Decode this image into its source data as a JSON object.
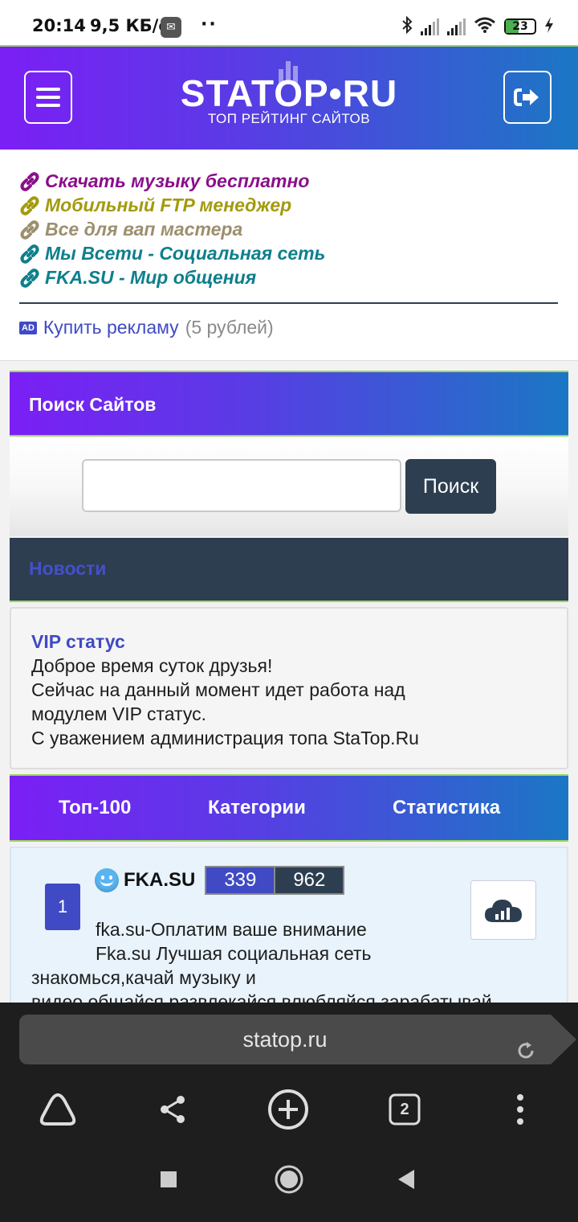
{
  "status_bar": {
    "time": "20:14",
    "speed": "9,5 КБ/с",
    "dots": "··",
    "battery": "23"
  },
  "header": {
    "logo_title": "STATOP•RU",
    "logo_subtitle": "ТОП РЕЙТИНГ САЙТОВ"
  },
  "links": [
    {
      "label": "Скачать музыку бесплатно",
      "color": "#8a0f8a"
    },
    {
      "label": "Мобильный FTP менеджер",
      "color": "#a39a0e"
    },
    {
      "label": "Все для вап мастера",
      "color": "#9b8f6e"
    },
    {
      "label": "Мы Всети - Социальная сеть",
      "color": "#0e7f8c"
    },
    {
      "label": "FKA.SU - Мир общения",
      "color": "#0e7f8c"
    }
  ],
  "ad": {
    "badge": "AD",
    "link": "Купить рекламу",
    "price": "(5 рублей)"
  },
  "search": {
    "title": "Поиск Сайтов",
    "value": "",
    "button": "Поиск"
  },
  "news": {
    "title": "Новости",
    "item_title": "VIP статус",
    "lines": [
      "Доброе время суток друзья!",
      "Сейчас на данный момент идет работа над",
      "модулем VIP статус.",
      "С уважением администрация топа StaTop.Ru"
    ]
  },
  "tabs": [
    "Топ-100",
    "Категории",
    "Статистика"
  ],
  "site": {
    "rank": "1",
    "name": "FKA.SU",
    "counter_1": "339",
    "counter_2": "962",
    "desc_1": "fka.su-Оплатим ваше внимание",
    "desc_2": "Fka.su Лучшая социальная сеть",
    "desc_3": "знакомься,качай музыку и",
    "desc_4": "видео,общайся,развлекайся,влюбляйся,зарабатывай"
  },
  "browser": {
    "url": "statop.ru",
    "tabs_count": "2"
  }
}
